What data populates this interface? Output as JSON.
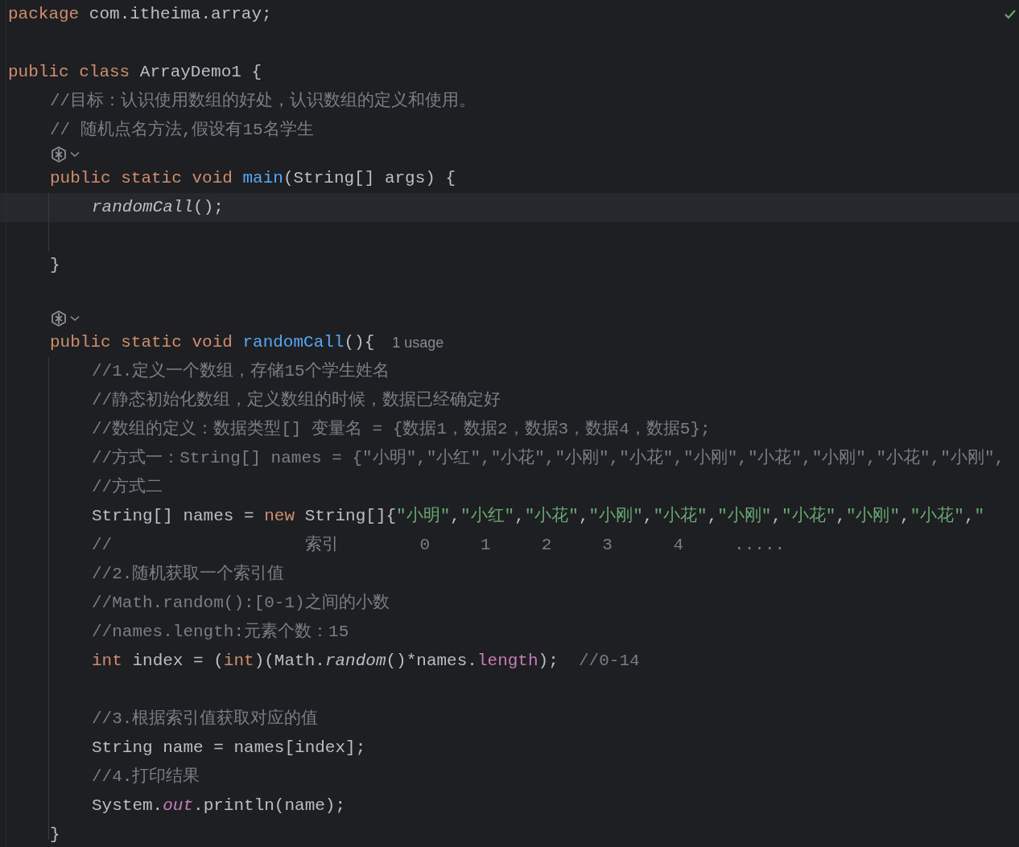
{
  "editor": {
    "inspection_ok": true,
    "lines": [
      {
        "kind": "code",
        "current": false,
        "tokens": [
          {
            "kind": "keyword",
            "text": "package "
          },
          {
            "kind": "plain",
            "text": "com.itheima.array;"
          }
        ]
      },
      {
        "kind": "blank"
      },
      {
        "kind": "code",
        "current": false,
        "tokens": [
          {
            "kind": "keyword",
            "text": "public class "
          },
          {
            "kind": "plain",
            "text": "ArrayDemo1 {"
          }
        ],
        "children": [
          {
            "kind": "code",
            "current": false,
            "tokens": [
              {
                "kind": "comment",
                "text": "//目标：认识使用数组的好处，认识数组的定义和使用。"
              }
            ]
          },
          {
            "kind": "code",
            "current": false,
            "tokens": [
              {
                "kind": "comment",
                "text": "// 随机点名方法,假设有15名学生"
              }
            ]
          },
          {
            "kind": "annotation"
          },
          {
            "kind": "code",
            "current": false,
            "tokens": [
              {
                "kind": "keyword",
                "text": "public static void "
              },
              {
                "kind": "method",
                "text": "main"
              },
              {
                "kind": "plain",
                "text": "(String[] args) {"
              }
            ],
            "children": [
              {
                "kind": "code",
                "current": true,
                "tokens": [
                  {
                    "kind": "static_call",
                    "text": "randomCall"
                  },
                  {
                    "kind": "plain",
                    "text": "();"
                  }
                ]
              },
              {
                "kind": "blank"
              }
            ]
          },
          {
            "kind": "code",
            "current": false,
            "tokens": [
              {
                "kind": "plain",
                "text": "}"
              }
            ]
          },
          {
            "kind": "blank"
          },
          {
            "kind": "annotation"
          },
          {
            "kind": "code",
            "current": false,
            "tokens": [
              {
                "kind": "keyword",
                "text": "public static void "
              },
              {
                "kind": "method",
                "text": "randomCall"
              },
              {
                "kind": "plain",
                "text": "(){"
              },
              {
                "kind": "hint",
                "text": "1 usage"
              }
            ],
            "children": [
              {
                "kind": "code",
                "current": false,
                "tokens": [
                  {
                    "kind": "comment",
                    "text": "//1.定义一个数组，存储15个学生姓名"
                  }
                ]
              },
              {
                "kind": "code",
                "current": false,
                "tokens": [
                  {
                    "kind": "comment",
                    "text": "//静态初始化数组，定义数组的时候，数据已经确定好"
                  }
                ]
              },
              {
                "kind": "code",
                "current": false,
                "tokens": [
                  {
                    "kind": "comment",
                    "text": "//数组的定义：数据类型[] 变量名 = {数据1，数据2，数据3，数据4，数据5};"
                  }
                ]
              },
              {
                "kind": "code",
                "current": false,
                "tokens": [
                  {
                    "kind": "comment",
                    "text": "//方式一：String[] names = {\"小明\",\"小红\",\"小花\",\"小刚\",\"小花\",\"小刚\",\"小花\",\"小刚\",\"小花\",\"小刚\","
                  }
                ]
              },
              {
                "kind": "code",
                "current": false,
                "tokens": [
                  {
                    "kind": "comment",
                    "text": "//方式二"
                  }
                ]
              },
              {
                "kind": "code",
                "current": false,
                "tokens": [
                  {
                    "kind": "plain",
                    "text": "String[] names = "
                  },
                  {
                    "kind": "keyword",
                    "text": "new "
                  },
                  {
                    "kind": "plain",
                    "text": "String[]{"
                  },
                  {
                    "kind": "string",
                    "text": "\"小明\""
                  },
                  {
                    "kind": "plain",
                    "text": ","
                  },
                  {
                    "kind": "string",
                    "text": "\"小红\""
                  },
                  {
                    "kind": "plain",
                    "text": ","
                  },
                  {
                    "kind": "string",
                    "text": "\"小花\""
                  },
                  {
                    "kind": "plain",
                    "text": ","
                  },
                  {
                    "kind": "string",
                    "text": "\"小刚\""
                  },
                  {
                    "kind": "plain",
                    "text": ","
                  },
                  {
                    "kind": "string",
                    "text": "\"小花\""
                  },
                  {
                    "kind": "plain",
                    "text": ","
                  },
                  {
                    "kind": "string",
                    "text": "\"小刚\""
                  },
                  {
                    "kind": "plain",
                    "text": ","
                  },
                  {
                    "kind": "string",
                    "text": "\"小花\""
                  },
                  {
                    "kind": "plain",
                    "text": ","
                  },
                  {
                    "kind": "string",
                    "text": "\"小刚\""
                  },
                  {
                    "kind": "plain",
                    "text": ","
                  },
                  {
                    "kind": "string",
                    "text": "\"小花\""
                  },
                  {
                    "kind": "plain",
                    "text": ","
                  },
                  {
                    "kind": "string",
                    "text": "\""
                  }
                ]
              },
              {
                "kind": "code",
                "current": false,
                "tokens": [
                  {
                    "kind": "comment",
                    "text": "//                   索引        0     1     2     3      4     ....."
                  }
                ]
              },
              {
                "kind": "code",
                "current": false,
                "tokens": [
                  {
                    "kind": "comment",
                    "text": "//2.随机获取一个索引值"
                  }
                ]
              },
              {
                "kind": "code",
                "current": false,
                "tokens": [
                  {
                    "kind": "comment",
                    "text": "//Math.random():[0-1)之间的小数"
                  }
                ]
              },
              {
                "kind": "code",
                "current": false,
                "tokens": [
                  {
                    "kind": "comment",
                    "text": "//names.length:元素个数：15"
                  }
                ]
              },
              {
                "kind": "code",
                "current": false,
                "tokens": [
                  {
                    "kind": "keyword",
                    "text": "int "
                  },
                  {
                    "kind": "plain",
                    "text": "index = ("
                  },
                  {
                    "kind": "keyword",
                    "text": "int"
                  },
                  {
                    "kind": "plain",
                    "text": ")(Math."
                  },
                  {
                    "kind": "static_call",
                    "text": "random"
                  },
                  {
                    "kind": "plain",
                    "text": "()*names."
                  },
                  {
                    "kind": "field",
                    "text": "length"
                  },
                  {
                    "kind": "plain",
                    "text": ");  "
                  },
                  {
                    "kind": "comment",
                    "text": "//0-14"
                  }
                ]
              },
              {
                "kind": "blank"
              },
              {
                "kind": "code",
                "current": false,
                "tokens": [
                  {
                    "kind": "comment",
                    "text": "//3.根据索引值获取对应的值"
                  }
                ]
              },
              {
                "kind": "code",
                "current": false,
                "tokens": [
                  {
                    "kind": "plain",
                    "text": "String name = names[index];"
                  }
                ]
              },
              {
                "kind": "code",
                "current": false,
                "tokens": [
                  {
                    "kind": "comment",
                    "text": "//4.打印结果"
                  }
                ]
              },
              {
                "kind": "code",
                "current": false,
                "tokens": [
                  {
                    "kind": "plain",
                    "text": "System."
                  },
                  {
                    "kind": "static_field",
                    "text": "out"
                  },
                  {
                    "kind": "plain",
                    "text": ".println(name);"
                  }
                ]
              }
            ]
          },
          {
            "kind": "code",
            "current": false,
            "tokens": [
              {
                "kind": "plain",
                "text": "}"
              }
            ]
          }
        ]
      }
    ]
  }
}
